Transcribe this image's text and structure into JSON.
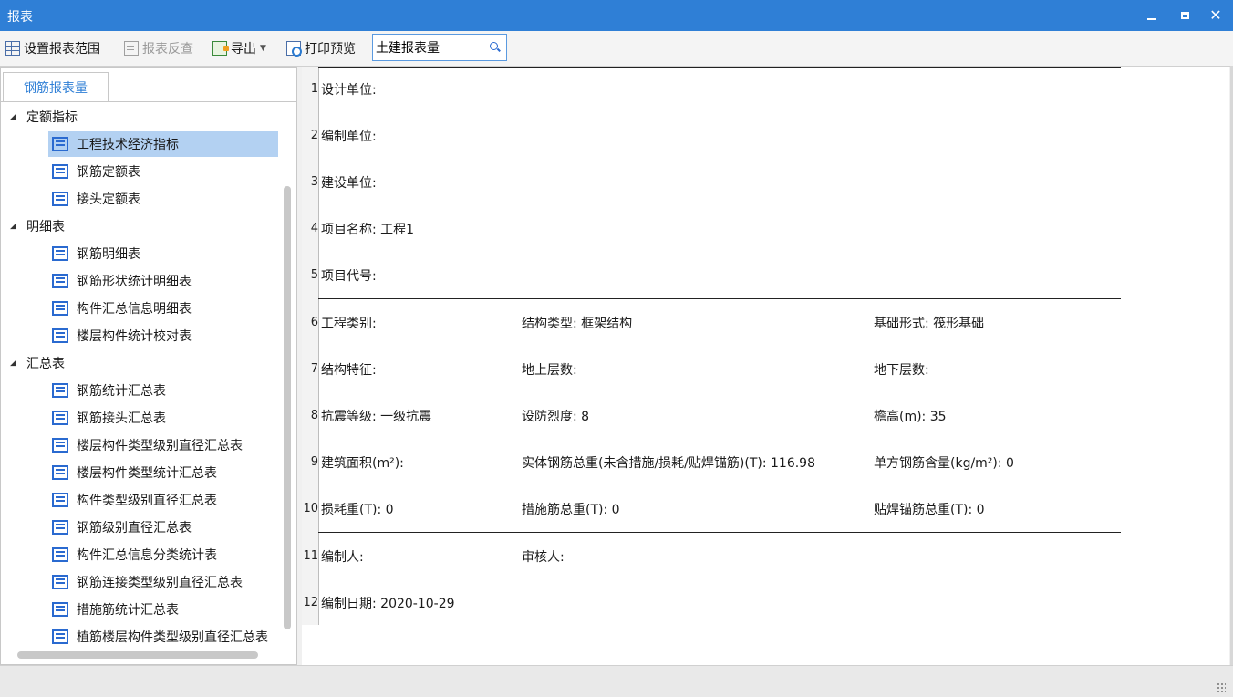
{
  "window": {
    "title": "报表"
  },
  "toolbar": {
    "set_range": "设置报表范围",
    "reverse_check": "报表反查",
    "export": "导出",
    "print_preview": "打印预览",
    "search_value": "土建报表量"
  },
  "panel": {
    "tab": "钢筋报表量",
    "tree": {
      "cat1": "定额指标",
      "c1_items": [
        "工程技术经济指标",
        "钢筋定额表",
        "接头定额表"
      ],
      "cat2": "明细表",
      "c2_items": [
        "钢筋明细表",
        "钢筋形状统计明细表",
        "构件汇总信息明细表",
        "楼层构件统计校对表"
      ],
      "cat3": "汇总表",
      "c3_items": [
        "钢筋统计汇总表",
        "钢筋接头汇总表",
        "楼层构件类型级别直径汇总表",
        "楼层构件类型统计汇总表",
        "构件类型级别直径汇总表",
        "钢筋级别直径汇总表",
        "构件汇总信息分类统计表",
        "钢筋连接类型级别直径汇总表",
        "措施筋统计汇总表",
        "植筋楼层构件类型级别直径汇总表"
      ]
    }
  },
  "report": {
    "row_numbers": [
      "1",
      "2",
      "3",
      "4",
      "5",
      "6",
      "7",
      "8",
      "9",
      "10",
      "11",
      "12"
    ],
    "r1": "设计单位:",
    "r2": "编制单位:",
    "r3": "建设单位:",
    "r4": "项目名称: 工程1",
    "r5": "项目代号:",
    "r6": [
      "工程类别:",
      "结构类型: 框架结构",
      "基础形式: 筏形基础"
    ],
    "r7": [
      "结构特征:",
      "地上层数:",
      "地下层数:"
    ],
    "r8": [
      "抗震等级: 一级抗震",
      "设防烈度: 8",
      "檐高(m): 35"
    ],
    "r9": [
      "建筑面积(m²):",
      "实体钢筋总重(未含措施/损耗/贴焊锚筋)(T): 116.98",
      "单方钢筋含量(kg/m²): 0"
    ],
    "r10": [
      "损耗重(T): 0",
      "措施筋总重(T): 0",
      "贴焊锚筋总重(T): 0"
    ],
    "r11": [
      "编制人:",
      "审核人:"
    ],
    "r12": "编制日期: 2020-10-29"
  }
}
